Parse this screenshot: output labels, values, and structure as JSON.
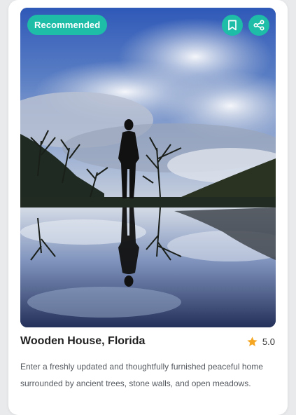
{
  "card": {
    "badge": "Recommended",
    "title": "Wooden House, Florida",
    "rating": "5.0",
    "description": "Enter a freshly updated and thoughtfully furnished peaceful home surrounded by ancient trees, stone walls, and open meadows."
  },
  "icons": {
    "bookmark": "bookmark-icon",
    "share": "share-icon",
    "star": "star-icon"
  },
  "colors": {
    "accent": "#1dbda8",
    "star": "#f5a623",
    "title": "#1f1f1f",
    "description": "#555a60"
  }
}
